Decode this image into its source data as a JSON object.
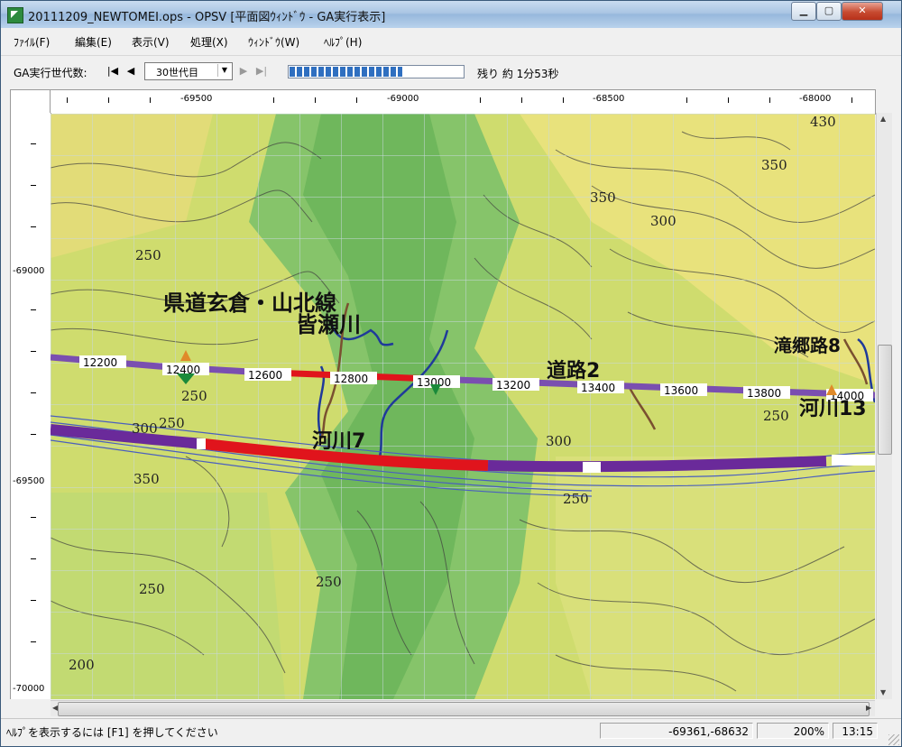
{
  "window": {
    "title": "20111209_NEWTOMEI.ops - OPSV [平面図ｳｨﾝﾄﾞｳ - GA実行表示]"
  },
  "menu": [
    "ﾌｧｲﾙ(F)",
    "編集(E)",
    "表示(V)",
    "処理(X)",
    "ｳｨﾝﾄﾞｳ(W)",
    "ﾍﾙﾌﾟ(H)"
  ],
  "toolbar": {
    "gen_label": "GA実行世代数:",
    "gen_value": "30世代目",
    "progress": 0.65,
    "remaining": "残り 約 1分53秒"
  },
  "ruler": {
    "top_labels": [
      "-69500",
      "-69000",
      "-68500",
      "-68000"
    ],
    "left_labels": [
      "-69000",
      "-69500",
      "-70000"
    ]
  },
  "map": {
    "colors": {
      "low": "#7fbf6a",
      "mid": "#b9d66a",
      "high": "#e6e07a",
      "road_red": "#e0141c",
      "road_purple": "#6a2a9a",
      "river": "#1f3a9a"
    },
    "contours": [
      "250",
      "250",
      "300",
      "350",
      "350",
      "300",
      "430",
      "300",
      "250",
      "250",
      "250",
      "350",
      "250",
      "200",
      "250"
    ],
    "stations": [
      "12200",
      "12400",
      "12600",
      "12800",
      "13000",
      "13200",
      "13400",
      "13600",
      "13800",
      "14000"
    ],
    "labels": {
      "road_pref": "県道玄倉・山北線",
      "river_minase": "皆瀬川",
      "road2": "道路2",
      "river7": "河川7",
      "river13": "河川13",
      "misc": "滝郷路8"
    }
  },
  "status": {
    "help": "ﾍﾙﾌﾟを表示するには [F1] を押してください",
    "coords": "-69361,-68632",
    "zoom": "200%",
    "time": "13:15"
  }
}
